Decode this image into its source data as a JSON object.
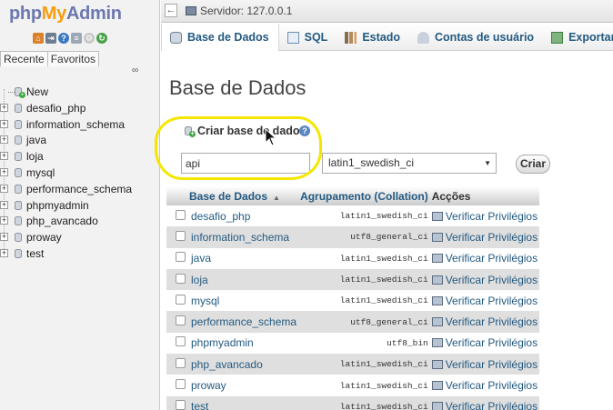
{
  "logo": {
    "php": "php",
    "my": "My",
    "admin": "Admin"
  },
  "nav": {
    "tabs": [
      "Recente",
      "Favoritos"
    ],
    "new_label": "New",
    "databases": [
      "desafio_php",
      "information_schema",
      "java",
      "loja",
      "mysql",
      "performance_schema",
      "phpmyadmin",
      "php_avancado",
      "proway",
      "test"
    ]
  },
  "topbar": {
    "server_label": "Servidor: 127.0.0.1"
  },
  "tabs": [
    {
      "label": "Base de Dados",
      "icon": "database-icon",
      "active": true
    },
    {
      "label": "SQL",
      "icon": "sql-icon",
      "active": false
    },
    {
      "label": "Estado",
      "icon": "status-chart-icon",
      "active": false
    },
    {
      "label": "Contas de usuário",
      "icon": "users-icon",
      "active": false
    },
    {
      "label": "Exportar",
      "icon": "export-icon",
      "active": false
    }
  ],
  "main": {
    "title": "Base de Dados",
    "create_label": "Criar base de dados",
    "db_name_value": "api",
    "collation_value": "latin1_swedish_ci",
    "create_button": "Criar"
  },
  "table": {
    "headers": {
      "name": "Base de Dados",
      "collation": "Agrupamento (Collation)",
      "actions": "Acções"
    },
    "action_label": "Verificar Privilégios",
    "rows": [
      {
        "name": "desafio_php",
        "collation": "latin1_swedish_ci"
      },
      {
        "name": "information_schema",
        "collation": "utf8_general_ci"
      },
      {
        "name": "java",
        "collation": "latin1_swedish_ci"
      },
      {
        "name": "loja",
        "collation": "latin1_swedish_ci"
      },
      {
        "name": "mysql",
        "collation": "latin1_swedish_ci"
      },
      {
        "name": "performance_schema",
        "collation": "utf8_general_ci"
      },
      {
        "name": "phpmyadmin",
        "collation": "utf8_bin"
      },
      {
        "name": "php_avancado",
        "collation": "latin1_swedish_ci"
      },
      {
        "name": "proway",
        "collation": "latin1_swedish_ci"
      },
      {
        "name": "test",
        "collation": "latin1_swedish_ci"
      }
    ]
  },
  "colors": {
    "link": "#235a81",
    "highlight": "#f5e600",
    "row_alt": "#dfdfdf"
  }
}
